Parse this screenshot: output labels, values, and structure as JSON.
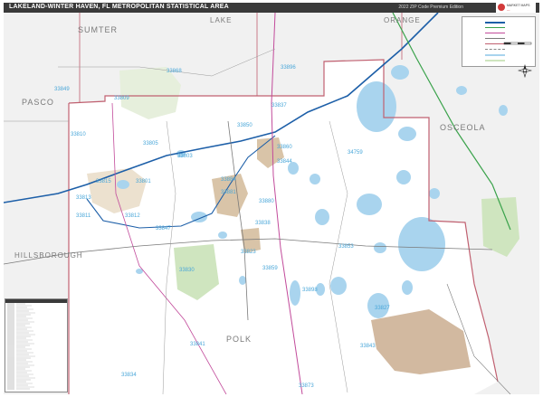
{
  "title": "LAKELAND-WINTER HAVEN, FL METROPOLITAN STATISTICAL AREA",
  "edition": "2022 ZIP Code Premium Edition",
  "publisher_logo": "MARKET MAPS",
  "counties": [
    {
      "id": "sumter",
      "label": "SUMTER"
    },
    {
      "id": "lake",
      "label": "LAKE"
    },
    {
      "id": "orange",
      "label": "ORANGE"
    },
    {
      "id": "pasco",
      "label": "PASCO"
    },
    {
      "id": "osceola",
      "label": "OSCEOLA"
    },
    {
      "id": "hillsborough",
      "label": "HILLSBOROUGH"
    },
    {
      "id": "polk",
      "label": "POLK"
    }
  ],
  "zip_codes": [
    {
      "id": "33868",
      "label": "33868"
    },
    {
      "id": "33849",
      "label": "33849"
    },
    {
      "id": "33809",
      "label": "33809"
    },
    {
      "id": "33810",
      "label": "33810"
    },
    {
      "id": "33805",
      "label": "33805"
    },
    {
      "id": "33815",
      "label": "33815"
    },
    {
      "id": "33801",
      "label": "33801"
    },
    {
      "id": "33813",
      "label": "33813"
    },
    {
      "id": "33811",
      "label": "33811"
    },
    {
      "id": "33812",
      "label": "33812"
    },
    {
      "id": "33803",
      "label": "33803"
    },
    {
      "id": "33837",
      "label": "33837"
    },
    {
      "id": "33844",
      "label": "33844"
    },
    {
      "id": "34759",
      "label": "34759"
    },
    {
      "id": "33850",
      "label": "33850"
    },
    {
      "id": "33884",
      "label": "33884"
    },
    {
      "id": "33881",
      "label": "33881"
    },
    {
      "id": "33880",
      "label": "33880"
    },
    {
      "id": "33830",
      "label": "33830"
    },
    {
      "id": "33838",
      "label": "33838"
    },
    {
      "id": "33859",
      "label": "33859"
    },
    {
      "id": "33853",
      "label": "33853"
    },
    {
      "id": "33898",
      "label": "33898"
    },
    {
      "id": "33827",
      "label": "33827"
    },
    {
      "id": "33841",
      "label": "33841"
    },
    {
      "id": "33843",
      "label": "33843"
    },
    {
      "id": "33834",
      "label": "33834"
    },
    {
      "id": "33873",
      "label": "33873"
    },
    {
      "id": "33896",
      "label": "33896"
    },
    {
      "id": "33847",
      "label": "33847"
    },
    {
      "id": "33860",
      "label": "33860"
    },
    {
      "id": "33823",
      "label": "33823"
    }
  ],
  "icons": [
    "north-arrow-icon",
    "scale-bar-icon",
    "legend-panel",
    "zip-index-table"
  ],
  "colors": {
    "water": "#a9d4ee",
    "zip_label": "#4aa7d9",
    "urban": "#d9c4a8",
    "park": "#cfe5bf",
    "boundary": "#c06070",
    "outside_area": "#f1f1f1",
    "highway": "#1d5fa8"
  }
}
